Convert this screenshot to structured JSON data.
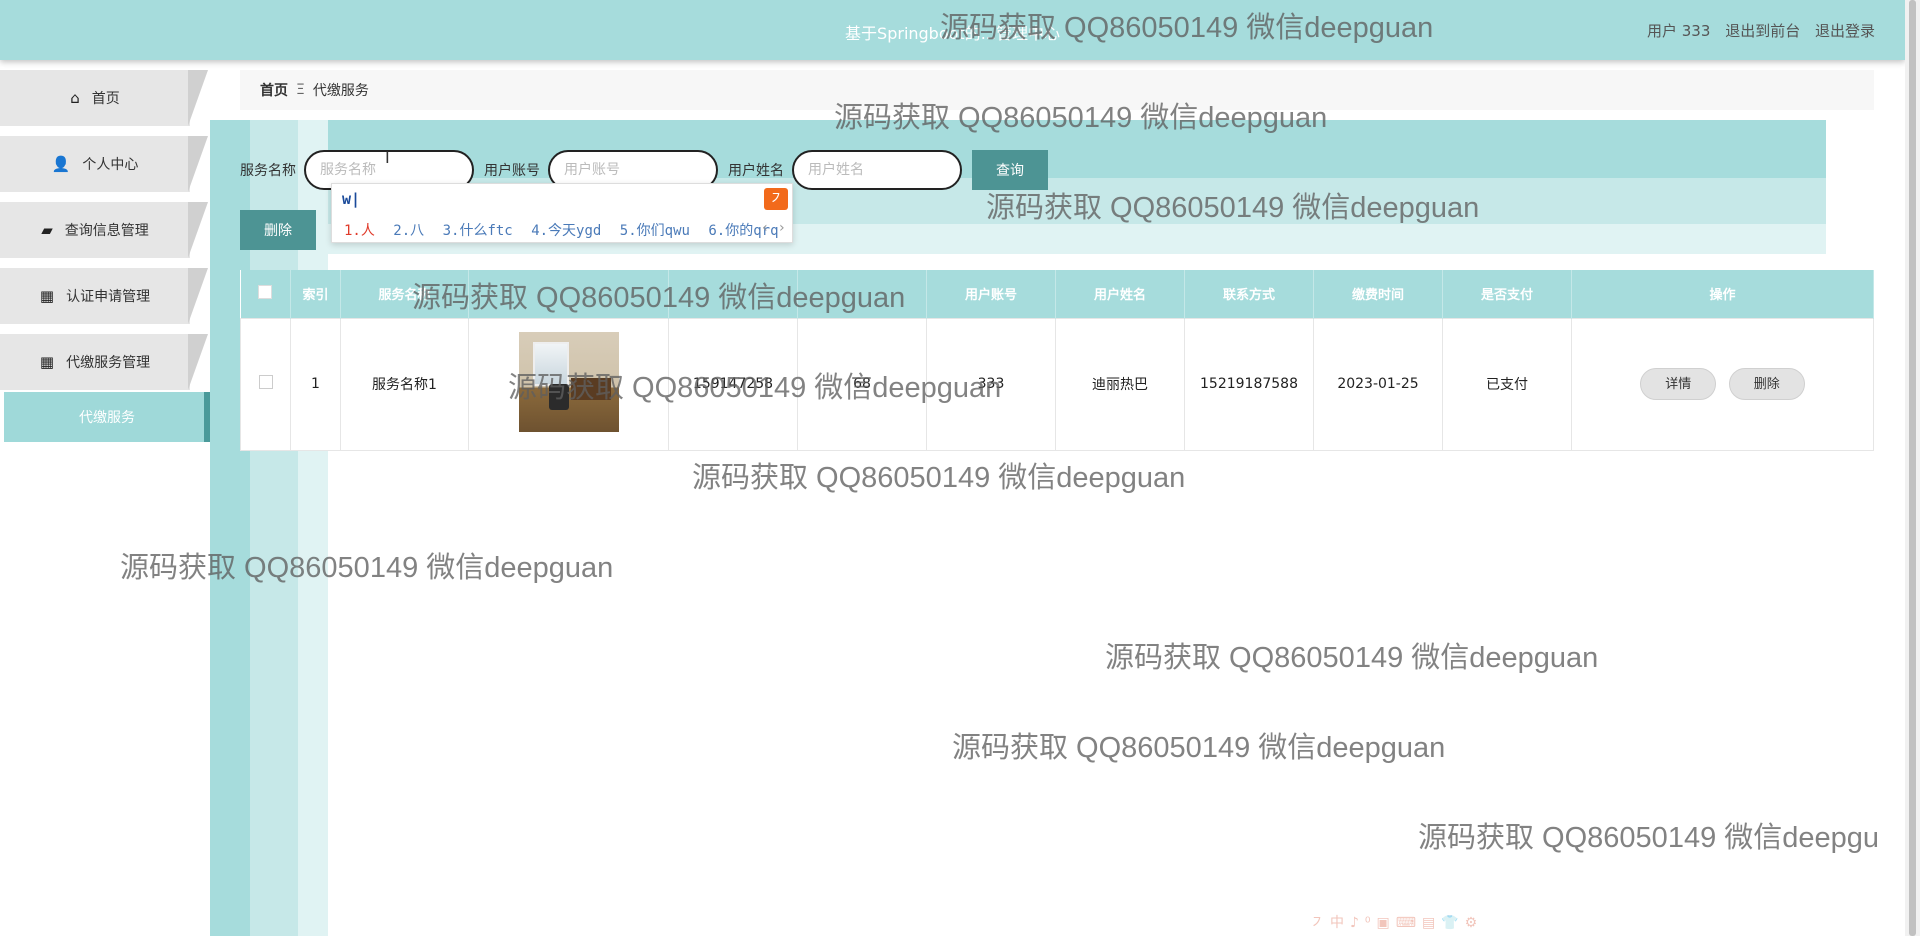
{
  "header": {
    "title": "基于Springboot的...管理中心",
    "user_label": "用户 333",
    "to_front": "退出到前台",
    "logout": "退出登录"
  },
  "sidebar": {
    "items": [
      {
        "label": "首页",
        "icon": "home-icon",
        "glyph": "⌂"
      },
      {
        "label": "个人中心",
        "icon": "user-icon",
        "glyph": "👤"
      },
      {
        "label": "查询信息管理",
        "icon": "ticket-icon",
        "glyph": "▰"
      },
      {
        "label": "认证申请管理",
        "icon": "grid-icon",
        "glyph": "▦"
      },
      {
        "label": "代缴服务管理",
        "icon": "grid-icon",
        "glyph": "▦"
      }
    ],
    "sub_item": "代缴服务"
  },
  "breadcrumb": {
    "home": "首页",
    "sep": "Ξ",
    "current": "代缴服务"
  },
  "search": {
    "service_label": "服务名称",
    "service_placeholder": "服务名称",
    "account_label": "用户账号",
    "account_placeholder": "用户账号",
    "name_label": "用户姓名",
    "name_placeholder": "用户姓名",
    "query_button": "查询"
  },
  "delete_button": "删除",
  "ime": {
    "typed": "w|",
    "logo": "㇇",
    "candidates": [
      "1.人",
      "2.八",
      "3.什么ftc",
      "4.今天ygd",
      "5.你们qwu",
      "6.你的qrq"
    ],
    "nav": "‹ ›"
  },
  "table": {
    "headers": [
      "",
      "索引",
      "服务名称",
      "",
      "",
      "",
      "用户账号",
      "用户姓名",
      "联系方式",
      "缴费时间",
      "是否支付",
      "操作"
    ],
    "rows": [
      {
        "index": "1",
        "service_name": "服务名称1",
        "col4": "159147258",
        "col5": "68",
        "account": "333",
        "name": "迪丽热巴",
        "phone": "15219187588",
        "pay_time": "2023-01-25",
        "paid": "已支付",
        "detail_btn": "详情",
        "delete_btn": "删除"
      }
    ]
  },
  "watermark": "源码获取 QQ86050149 微信deepguan",
  "watermark_cut": "源码获取 QQ86050149 微信deepgu",
  "bottom_toolbar": "㇇中♪⁰▣⌨▤👕⚙"
}
